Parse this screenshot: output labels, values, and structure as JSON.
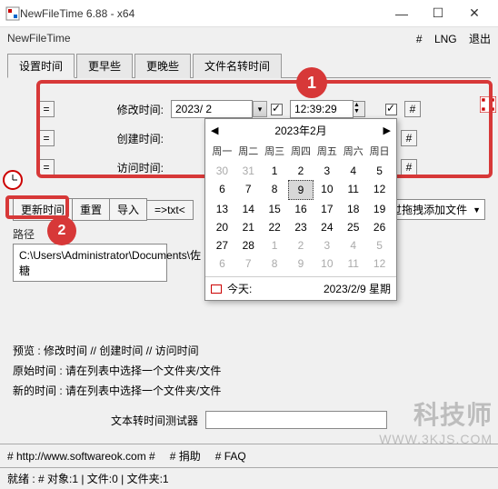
{
  "window": {
    "title": "NewFileTime 6.88 - x64"
  },
  "menubar": {
    "app": "NewFileTime",
    "hash": "#",
    "lng": "LNG",
    "exit": "退出"
  },
  "tabs": {
    "t1": "设置时间",
    "t2": "更早些",
    "t3": "更晚些",
    "t4": "文件名转时间"
  },
  "rows": {
    "eq": "=",
    "modify": {
      "label": "修改时间:",
      "date": "2023/ 2",
      "time": "12:39:29"
    },
    "create": {
      "label": "创建时间:"
    },
    "access": {
      "label": "访问时间:"
    }
  },
  "hash": "#",
  "toolbar": {
    "update": "更新时间",
    "reset": "重置",
    "import": "导入",
    "export": "=>txt<",
    "adddrag": "通过拖拽添加文件"
  },
  "path": {
    "label": "路径",
    "value": "C:\\Users\\Administrator\\Documents\\佐糖"
  },
  "preview": {
    "header": "预览 :    修改时间    //    创建时间    //    访问时间",
    "orig": "原始时间 : 请在列表中选择一个文件夹/文件",
    "new": "新的时间 : 请在列表中选择一个文件夹/文件"
  },
  "tester": {
    "label": "文本转时间测试器"
  },
  "footer": {
    "url": "# http://www.softwareok.com #",
    "donate": "# 捐助",
    "faq": "# FAQ"
  },
  "status": "就绪 :   # 对象:1  | 文件:0   | 文件夹:1",
  "calendar": {
    "title": "2023年2月",
    "prev": "◀",
    "next": "▶",
    "dow": [
      "周一",
      "周二",
      "周三",
      "周四",
      "周五",
      "周六",
      "周日"
    ],
    "cells": [
      {
        "d": "30",
        "o": true
      },
      {
        "d": "31",
        "o": true
      },
      {
        "d": "1"
      },
      {
        "d": "2"
      },
      {
        "d": "3"
      },
      {
        "d": "4"
      },
      {
        "d": "5"
      },
      {
        "d": "6"
      },
      {
        "d": "7"
      },
      {
        "d": "8"
      },
      {
        "d": "9",
        "sel": true
      },
      {
        "d": "10"
      },
      {
        "d": "11"
      },
      {
        "d": "12"
      },
      {
        "d": "13"
      },
      {
        "d": "14"
      },
      {
        "d": "15"
      },
      {
        "d": "16"
      },
      {
        "d": "17"
      },
      {
        "d": "18"
      },
      {
        "d": "19"
      },
      {
        "d": "20"
      },
      {
        "d": "21"
      },
      {
        "d": "22"
      },
      {
        "d": "23"
      },
      {
        "d": "24"
      },
      {
        "d": "25"
      },
      {
        "d": "26"
      },
      {
        "d": "27"
      },
      {
        "d": "28"
      },
      {
        "d": "1",
        "o": true
      },
      {
        "d": "2",
        "o": true
      },
      {
        "d": "3",
        "o": true
      },
      {
        "d": "4",
        "o": true
      },
      {
        "d": "5",
        "o": true
      },
      {
        "d": "6",
        "o": true
      },
      {
        "d": "7",
        "o": true
      },
      {
        "d": "8",
        "o": true
      },
      {
        "d": "9",
        "o": true
      },
      {
        "d": "10",
        "o": true
      },
      {
        "d": "11",
        "o": true
      },
      {
        "d": "12",
        "o": true
      }
    ],
    "today_label": "今天:",
    "today_value": "2023/2/9 星期"
  },
  "callouts": {
    "c1": "1",
    "c2": "2"
  },
  "watermark": {
    "brand": "科技师",
    "url": "WWW.3KJS.COM"
  }
}
